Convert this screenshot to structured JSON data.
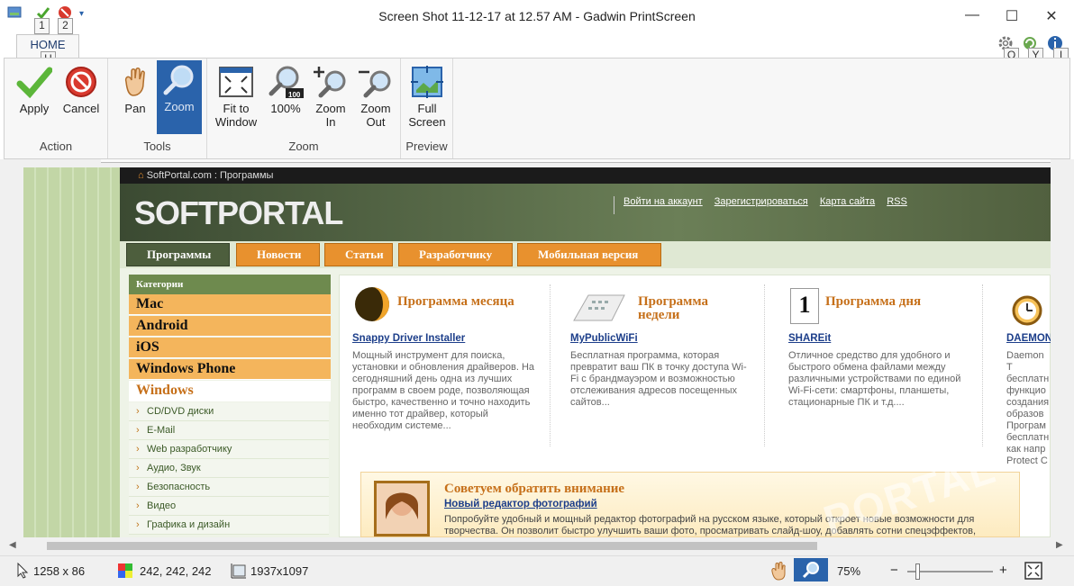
{
  "window": {
    "title": "Screen Shot 11-12-17 at 12.57 AM - Gadwin PrintScreen",
    "quick_access_keytips": [
      "1",
      "2"
    ],
    "controls": {
      "minimize": "—",
      "maximize": "☐",
      "close": "✕"
    },
    "right_keytips": [
      "O",
      "Y",
      "I"
    ]
  },
  "ribbon": {
    "home_tab": "HOME",
    "home_keytip": "H",
    "groups": [
      {
        "label": "Action",
        "buttons": [
          {
            "label": "Apply"
          },
          {
            "label": "Cancel"
          }
        ]
      },
      {
        "label": "Tools",
        "buttons": [
          {
            "label": "Pan"
          },
          {
            "label": "Zoom"
          }
        ]
      },
      {
        "label": "Zoom",
        "buttons": [
          {
            "label": "Fit to\nWindow"
          },
          {
            "label": "100%"
          },
          {
            "label": "Zoom\nIn"
          },
          {
            "label": "Zoom\nOut"
          }
        ]
      },
      {
        "label": "Preview",
        "buttons": [
          {
            "label": "Full\nScreen"
          }
        ]
      }
    ],
    "zoom_badge": "100"
  },
  "screenshot": {
    "breadcrumb": "SoftPortal.com : Программы",
    "logo": "SOFTPORTAL",
    "top_links": [
      "Войти на аккаунт",
      "Зарегистрироваться",
      "Карта сайта",
      "RSS"
    ],
    "nav": [
      "Программы",
      "Новости",
      "Статьи",
      "Разработчику",
      "Мобильная версия"
    ],
    "categories_title": "Категории",
    "categories": [
      "Mac",
      "Android",
      "iOS",
      "Windows Phone",
      "Windows"
    ],
    "subcategories": [
      "CD/DVD диски",
      "E-Mail",
      "Web разработчику",
      "Аудио, Звук",
      "Безопасность",
      "Видео",
      "Графика и дизайн"
    ],
    "columns": [
      {
        "heading": "Программа месяца",
        "link": "Snappy Driver Installer",
        "text": "Мощный инструмент для поиска, установки и обновления драйверов. На сегодняшний день одна из лучших программ в своем роде, позволяющая быстро, качественно и точно находить именно тот драйвер, который необходим системе..."
      },
      {
        "heading": "Программа недели",
        "link": "MyPublicWiFi",
        "text": "Бесплатная программа, которая превратит ваш ПК в точку доступа Wi-Fi с брандмауэром и возможностью отслеживания адресов посещенных сайтов..."
      },
      {
        "heading": "Программа дня",
        "link": "SHAREit",
        "text": "Отличное средство для удобного и быстрого обмена файлами между различными устройствами по единой Wi-Fi-сети: смартфоны, планшеты, стационарные ПК и т.д...."
      },
      {
        "heading": "",
        "link": "DAEMON",
        "text": "Daemon T бесплатн функцио создания образов Програм бесплатн как напр Protect C"
      }
    ],
    "calendar_day": "1",
    "recommend": {
      "heading": "Советуем обратить внимание",
      "link": "Новый редактор фотографий",
      "text": "Попробуйте удобный и мощный редактор фотографий на русском языке, который откроет новые возможности для творчества. Он позволит быстро улучшить ваши фото, просматривать слайд-шоу, добавлять сотни спецэффектов,"
    },
    "watermark": "PORTAL"
  },
  "status": {
    "selection_size": "1258 x 86",
    "color_value": "242, 242, 242",
    "image_size": "1937x1097",
    "zoom_percent": "75%",
    "zoom_minus": "−",
    "zoom_plus": "+",
    "zoom_level_fraction": 0.1
  }
}
